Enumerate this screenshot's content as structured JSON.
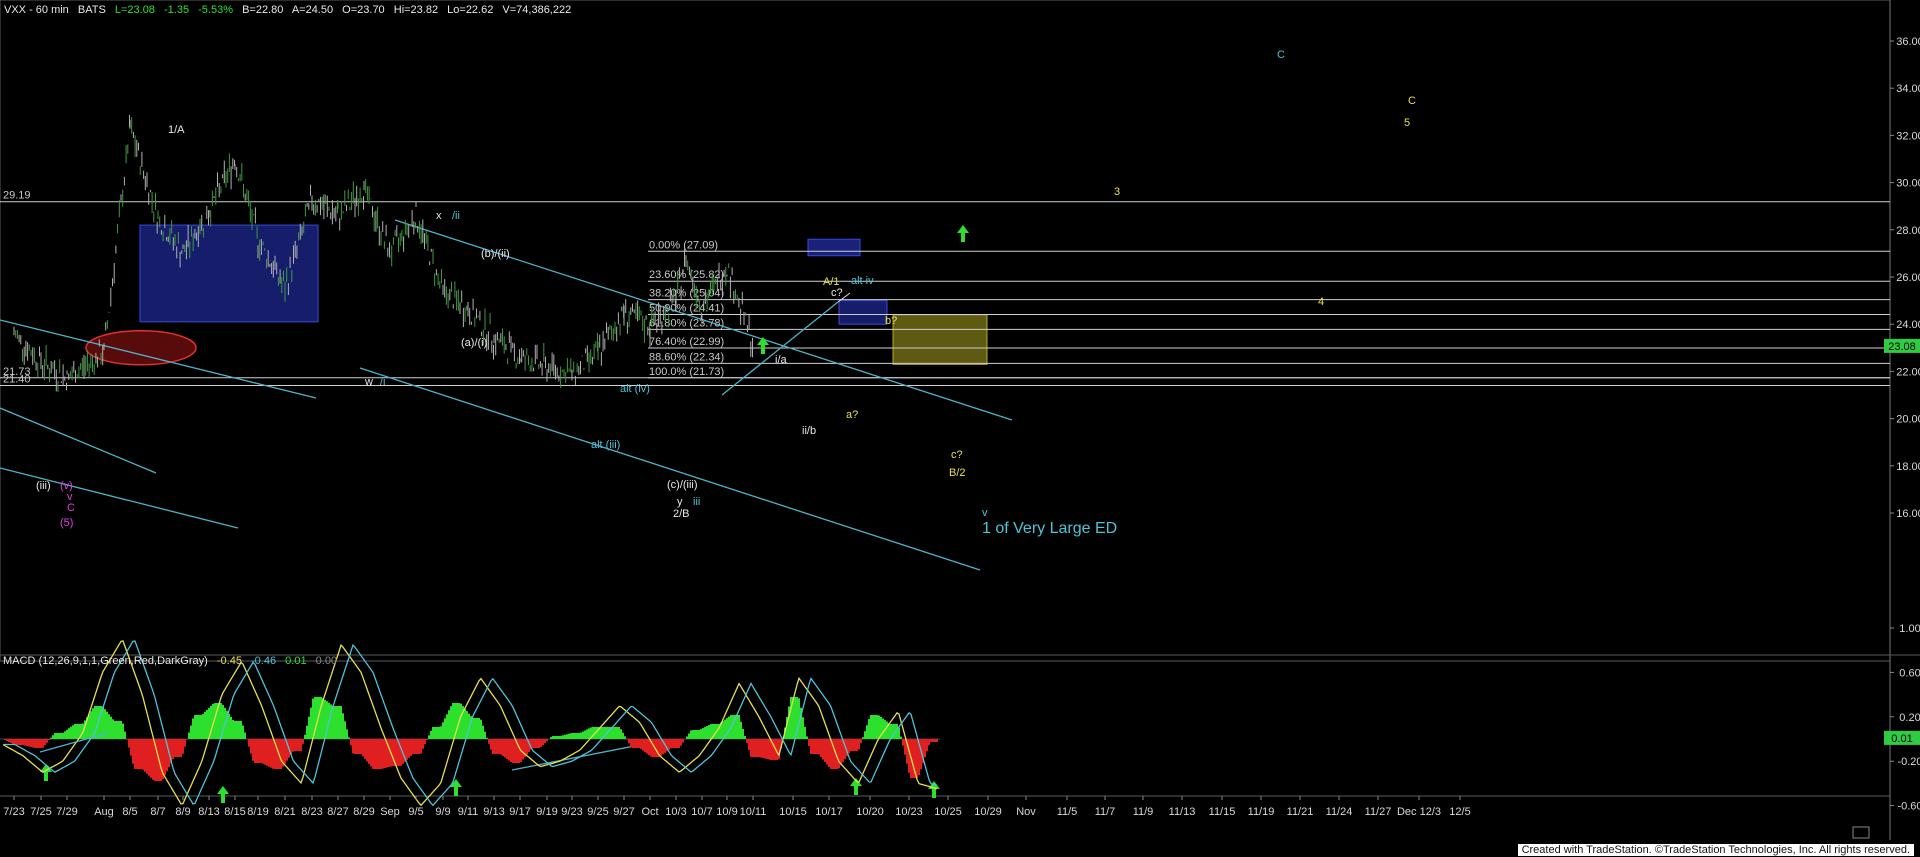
{
  "header": {
    "symbol": "VXX - 60 min",
    "exchange": "BATS",
    "last": "L=23.08",
    "change": "-1.35",
    "change_pct": "-5.53%",
    "bid": "B=22.80",
    "ask": "A=24.50",
    "open": "O=23.70",
    "high": "Hi=23.82",
    "low": "Lo=22.62",
    "volume": "V=74,386,222"
  },
  "colors": {
    "background": "#000000",
    "price_bars": "#3f9a3f",
    "channel": "#4fb3c8",
    "fib_lines": "#d0d0d0",
    "macd_up": "#2ee02e",
    "macd_down": "#e02020",
    "arrows": "#2ee02e",
    "box_blue": "#1a237e",
    "box_olive": "#6e6a14",
    "ellipse": "#c01818",
    "cyan_label": "#4fc3d8",
    "yellow_label": "#e8e050",
    "magenta_label": "#e040e0"
  },
  "chart_data": [
    {
      "type": "candlestick",
      "title": "VXX - 60 min",
      "x_tick_labels": [
        "7/23",
        "7/25",
        "7/29",
        "Aug",
        "8/5",
        "8/7",
        "8/9",
        "8/13",
        "8/15",
        "8/19",
        "8/21",
        "8/23",
        "8/27",
        "8/29",
        "Sep",
        "9/5",
        "9/9",
        "9/11",
        "9/13",
        "9/17",
        "9/19",
        "9/23",
        "9/25",
        "9/27",
        "Oct",
        "10/3",
        "10/7",
        "10/9",
        "10/11",
        "10/15",
        "10/17",
        "10/20",
        "10/23",
        "10/25",
        "10/29",
        "Nov",
        "11/5",
        "11/7",
        "11/9",
        "11/13",
        "11/15",
        "11/19",
        "11/21",
        "11/24",
        "11/27",
        "Dec 12/3",
        "12/5"
      ],
      "y_tick_labels": [
        "16.00",
        "18.00",
        "20.00",
        "22.00",
        "24.00",
        "26.00",
        "28.00",
        "30.00",
        "32.00",
        "34.00",
        "36.00"
      ],
      "ylim": [
        15,
        37
      ],
      "last_price": "23.08",
      "series": [
        {
          "values": [
            [
              "7/23",
              23.6
            ],
            [
              "7/25",
              22.4
            ],
            [
              "7/29",
              21.7
            ],
            [
              "Aug",
              22.8
            ],
            [
              "8/5",
              32.3
            ],
            [
              "8/7",
              28.5
            ],
            [
              "8/9",
              27.0
            ],
            [
              "8/13",
              28.8
            ],
            [
              "8/15",
              31.0
            ],
            [
              "8/19",
              27.6
            ],
            [
              "8/21",
              25.5
            ],
            [
              "8/23",
              29.3
            ],
            [
              "8/27",
              28.6
            ],
            [
              "8/29",
              29.7
            ],
            [
              "Sep",
              27.0
            ],
            [
              "9/5",
              28.6
            ],
            [
              "9/9",
              25.4
            ],
            [
              "9/11",
              24.6
            ],
            [
              "9/13",
              23.4
            ],
            [
              "9/17",
              22.6
            ],
            [
              "9/19",
              22.2
            ],
            [
              "9/23",
              21.9
            ],
            [
              "9/25",
              22.8
            ],
            [
              "9/27",
              24.5
            ],
            [
              "Oct",
              23.9
            ],
            [
              "10/3",
              25.0
            ],
            [
              "10/3",
              26.8
            ],
            [
              "10/7",
              24.7
            ],
            [
              "10/9",
              26.5
            ],
            [
              "10/11",
              23.1
            ]
          ]
        }
      ],
      "horizontal_levels": [
        {
          "label": "29.19",
          "value": 29.19
        },
        {
          "label": "0.00% (27.09)",
          "value": 27.09
        },
        {
          "label": "23.60% (25.82)",
          "value": 25.82
        },
        {
          "label": "38.20% (25.04)",
          "value": 25.04
        },
        {
          "label": "50.00% (24.41)",
          "value": 24.41
        },
        {
          "label": "61.80% (23.78)",
          "value": 23.78
        },
        {
          "label": "76.40% (22.99)",
          "value": 22.99
        },
        {
          "label": "88.60% (22.34)",
          "value": 22.34
        },
        {
          "label": "100.0% (21.73)",
          "value": 21.73
        },
        {
          "label": "21.73",
          "value": 21.73
        },
        {
          "label": "21.40",
          "value": 21.4
        }
      ],
      "wave_labels": [
        {
          "text": "1/A",
          "color": "white"
        },
        {
          "text": "x",
          "color": "white"
        },
        {
          "text": "/ii",
          "color": "cyan"
        },
        {
          "text": "(b)/(ii)",
          "color": "white"
        },
        {
          "text": "(a)/(i)",
          "color": "white"
        },
        {
          "text": "w",
          "color": "white"
        },
        {
          "text": "/i",
          "color": "cyan"
        },
        {
          "text": "alt (iv)",
          "color": "cyan"
        },
        {
          "text": "alt (iii)",
          "color": "cyan"
        },
        {
          "text": "(c)/(iii)",
          "color": "white"
        },
        {
          "text": "y",
          "color": "white"
        },
        {
          "text": "iii",
          "color": "cyan"
        },
        {
          "text": "2/B",
          "color": "white"
        },
        {
          "text": "i/a",
          "color": "white"
        },
        {
          "text": "ii/b",
          "color": "white"
        },
        {
          "text": "A/1",
          "color": "yellow"
        },
        {
          "text": "alt iv",
          "color": "cyan"
        },
        {
          "text": "c?",
          "color": "white"
        },
        {
          "text": "b?",
          "color": "yellow"
        },
        {
          "text": "a?",
          "color": "yellow"
        },
        {
          "text": "c?",
          "color": "yellow"
        },
        {
          "text": "B/2",
          "color": "yellow"
        },
        {
          "text": "v",
          "color": "cyan"
        },
        {
          "text": "1 of Very Large ED",
          "color": "cyan"
        },
        {
          "text": "C",
          "color": "cyan"
        },
        {
          "text": "C",
          "color": "yellow"
        },
        {
          "text": "5",
          "color": "yellow"
        },
        {
          "text": "3",
          "color": "yellow"
        },
        {
          "text": "4",
          "color": "yellow"
        },
        {
          "text": "(iii)",
          "color": "white"
        },
        {
          "text": "(v)",
          "color": "magenta"
        },
        {
          "text": "v",
          "color": "magenta"
        },
        {
          "text": "C",
          "color": "magenta"
        },
        {
          "text": "(5)",
          "color": "magenta"
        }
      ]
    },
    {
      "type": "line",
      "title": "MACD (12,26,9,1,1,Green,Red,DarkGray)",
      "readout": [
        "-0.45",
        "-0.46",
        "0.01",
        "0.00"
      ],
      "y_tick_labels": [
        "1.00",
        "0.60",
        "0.20",
        "-0.20",
        "-0.60"
      ],
      "ylim": [
        -0.95,
        1.2
      ],
      "last_value": "0.01",
      "series": [
        {
          "values": [
            -0.05,
            -0.15,
            -0.3,
            -0.2,
            0.05,
            0.6,
            0.9,
            0.4,
            -0.3,
            -0.6,
            -0.2,
            0.4,
            0.7,
            0.3,
            -0.2,
            -0.4,
            0.3,
            0.85,
            0.6,
            0.1,
            -0.35,
            -0.6,
            -0.4,
            0.2,
            0.55,
            0.3,
            -0.1,
            -0.25,
            -0.2,
            -0.1,
            0.1,
            0.3,
            0.15,
            -0.15,
            -0.3,
            -0.15,
            0.1,
            0.5,
            0.2,
            -0.15,
            0.55,
            0.3,
            -0.2,
            -0.4,
            0.0,
            0.25,
            -0.4,
            -0.45
          ]
        }
      ]
    }
  ],
  "footer": "Created with TradeStation. ©TradeStation Technologies, Inc. All rights reserved."
}
